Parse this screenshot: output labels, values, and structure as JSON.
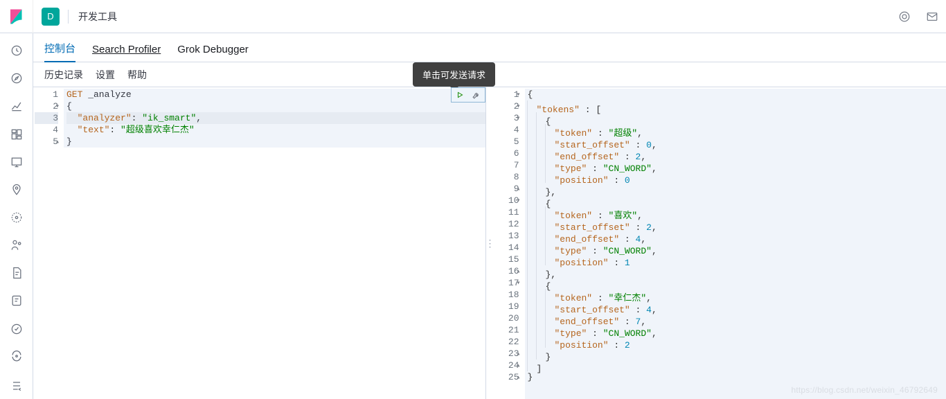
{
  "header": {
    "space_letter": "D",
    "title": "开发工具"
  },
  "tabs": [
    "控制台",
    "Search Profiler",
    "Grok Debugger"
  ],
  "subnav": [
    "历史记录",
    "设置",
    "帮助"
  ],
  "tooltip": "单击可发送请求",
  "request": {
    "method": "GET",
    "endpoint": "_analyze",
    "body_lines": [
      {
        "n": 2,
        "text": "{",
        "fold": "▾"
      },
      {
        "n": 3,
        "indent": "  ",
        "key": "\"analyzer\"",
        "val": "\"ik_smart\"",
        "trail": ",",
        "current": true
      },
      {
        "n": 4,
        "indent": "  ",
        "key": "\"text\"",
        "val": "\"超级喜欢幸仁杰\""
      },
      {
        "n": 5,
        "text": "}",
        "fold": "▴"
      }
    ]
  },
  "response_lines": [
    {
      "n": 1,
      "t": "{",
      "fold": "▾"
    },
    {
      "n": 2,
      "i": 1,
      "key": "\"tokens\"",
      "sep": " : ",
      "after": "[",
      "fold": "▾"
    },
    {
      "n": 3,
      "i": 2,
      "t": "{",
      "fold": "▾"
    },
    {
      "n": 4,
      "i": 3,
      "key": "\"token\"",
      "sep": " : ",
      "str": "\"超级\"",
      "trail": ","
    },
    {
      "n": 5,
      "i": 3,
      "key": "\"start_offset\"",
      "sep": " : ",
      "num": "0",
      "trail": ","
    },
    {
      "n": 6,
      "i": 3,
      "key": "\"end_offset\"",
      "sep": " : ",
      "num": "2",
      "trail": ","
    },
    {
      "n": 7,
      "i": 3,
      "key": "\"type\"",
      "sep": " : ",
      "str": "\"CN_WORD\"",
      "trail": ","
    },
    {
      "n": 8,
      "i": 3,
      "key": "\"position\"",
      "sep": " : ",
      "num": "0"
    },
    {
      "n": 9,
      "i": 2,
      "t": "},",
      "fold": "▴"
    },
    {
      "n": 10,
      "i": 2,
      "t": "{",
      "fold": "▾"
    },
    {
      "n": 11,
      "i": 3,
      "key": "\"token\"",
      "sep": " : ",
      "str": "\"喜欢\"",
      "trail": ","
    },
    {
      "n": 12,
      "i": 3,
      "key": "\"start_offset\"",
      "sep": " : ",
      "num": "2",
      "trail": ","
    },
    {
      "n": 13,
      "i": 3,
      "key": "\"end_offset\"",
      "sep": " : ",
      "num": "4",
      "trail": ","
    },
    {
      "n": 14,
      "i": 3,
      "key": "\"type\"",
      "sep": " : ",
      "str": "\"CN_WORD\"",
      "trail": ","
    },
    {
      "n": 15,
      "i": 3,
      "key": "\"position\"",
      "sep": " : ",
      "num": "1"
    },
    {
      "n": 16,
      "i": 2,
      "t": "},",
      "fold": "▴"
    },
    {
      "n": 17,
      "i": 2,
      "t": "{",
      "fold": "▾"
    },
    {
      "n": 18,
      "i": 3,
      "key": "\"token\"",
      "sep": " : ",
      "str": "\"幸仁杰\"",
      "trail": ","
    },
    {
      "n": 19,
      "i": 3,
      "key": "\"start_offset\"",
      "sep": " : ",
      "num": "4",
      "trail": ","
    },
    {
      "n": 20,
      "i": 3,
      "key": "\"end_offset\"",
      "sep": " : ",
      "num": "7",
      "trail": ","
    },
    {
      "n": 21,
      "i": 3,
      "key": "\"type\"",
      "sep": " : ",
      "str": "\"CN_WORD\"",
      "trail": ","
    },
    {
      "n": 22,
      "i": 3,
      "key": "\"position\"",
      "sep": " : ",
      "num": "2"
    },
    {
      "n": 23,
      "i": 2,
      "t": "}",
      "fold": "▴"
    },
    {
      "n": 24,
      "i": 1,
      "t": "]",
      "fold": "▴"
    },
    {
      "n": 25,
      "t": "}",
      "fold": "▴"
    }
  ],
  "watermark": "https://blog.csdn.net/weixin_46792649"
}
